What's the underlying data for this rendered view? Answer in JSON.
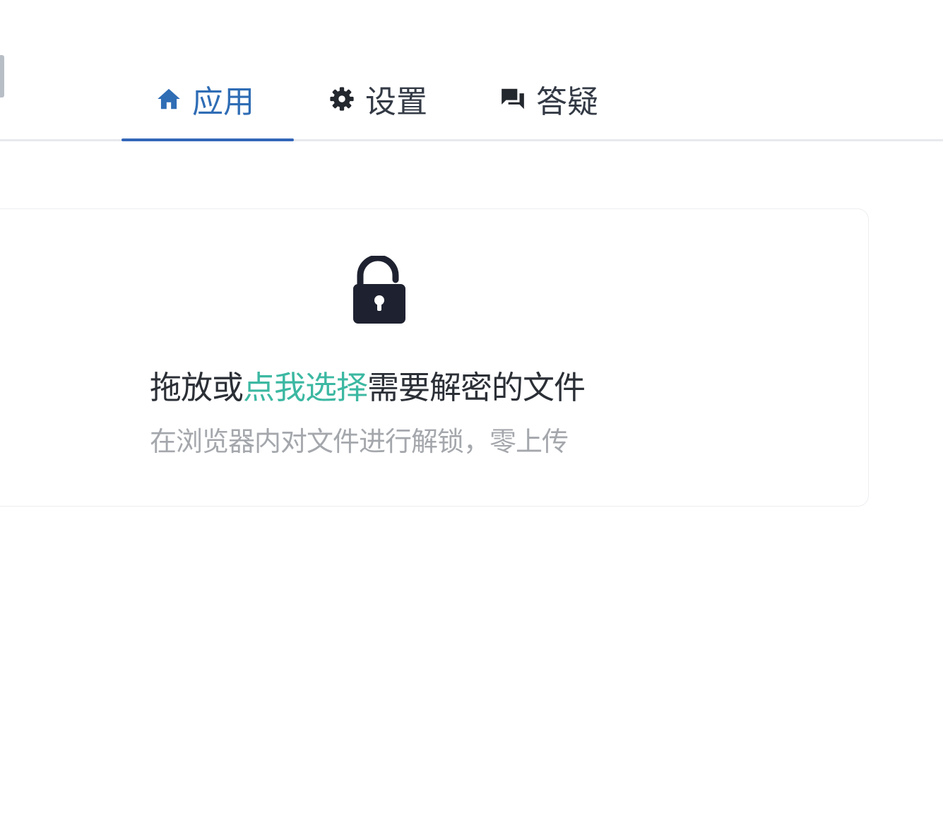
{
  "nav": {
    "tabs": [
      {
        "label": "应用",
        "icon": "home-icon",
        "active": true
      },
      {
        "label": "设置",
        "icon": "gear-icon",
        "active": false
      },
      {
        "label": "答疑",
        "icon": "chat-icon",
        "active": false
      }
    ],
    "active_color": "#2f6db5"
  },
  "dropzone": {
    "icon": "unlock-icon",
    "prefix": "拖放或",
    "link": "点我选择",
    "suffix": "需要解密的文件",
    "subtitle": "在浏览器内对文件进行解锁，零上传",
    "link_color": "#3cb8a2"
  }
}
